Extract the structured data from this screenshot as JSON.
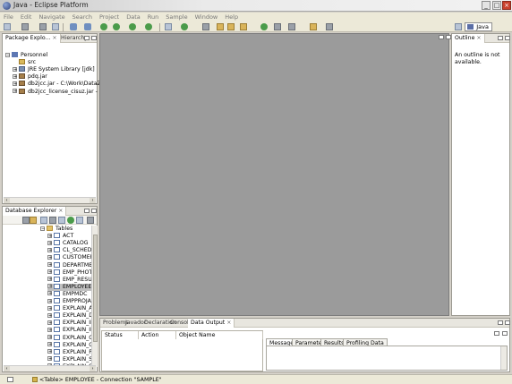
{
  "window": {
    "title": "Java - Eclipse Platform",
    "buttons": {
      "minimize": "_",
      "maximize": "□",
      "close": "×"
    }
  },
  "menu": [
    "File",
    "Edit",
    "Navigate",
    "Search",
    "Project",
    "Data",
    "Run",
    "Sample",
    "Window",
    "Help"
  ],
  "perspective": {
    "label": "Java"
  },
  "package_explorer": {
    "tabs": [
      {
        "label": "Package Explo...",
        "close": "×"
      },
      {
        "label": "Hierarchy"
      }
    ],
    "tree": [
      {
        "label": "Personnel",
        "expander": "−",
        "icon": "project-icon",
        "depth": 0
      },
      {
        "label": "src",
        "expander": "",
        "icon": "source-folder-icon",
        "depth": 1
      },
      {
        "label": "JRE System Library [jdk]",
        "expander": "+",
        "icon": "library-icon",
        "depth": 1
      },
      {
        "label": "pdq.jar",
        "expander": "+",
        "icon": "jar-icon",
        "depth": 1
      },
      {
        "label": "db2jcc.jar - C:\\Work\\DataZero\\",
        "expander": "+",
        "icon": "jar-icon",
        "depth": 1
      },
      {
        "label": "db2jcc_license_cisuz.jar - C:\\W",
        "expander": "+",
        "icon": "jar-icon",
        "depth": 1
      }
    ],
    "scroll": {
      "left": "‹",
      "right": "›"
    }
  },
  "database_explorer": {
    "tab": {
      "label": "Database Explorer",
      "close": "×"
    },
    "tree": [
      {
        "label": "Tables",
        "expander": "−",
        "icon": "folder-icon",
        "depth": 0
      },
      {
        "label": "ACT",
        "expander": "+",
        "icon": "table-icon",
        "depth": 1
      },
      {
        "label": "CATALOG",
        "expander": "+",
        "icon": "table-icon",
        "depth": 1
      },
      {
        "label": "CL_SCHED",
        "expander": "+",
        "icon": "table-icon",
        "depth": 1
      },
      {
        "label": "CUSTOMER",
        "expander": "+",
        "icon": "table-icon",
        "depth": 1
      },
      {
        "label": "DEPARTMEN",
        "expander": "+",
        "icon": "table-icon",
        "depth": 1
      },
      {
        "label": "EMP_PHOTO",
        "expander": "+",
        "icon": "table-icon",
        "depth": 1
      },
      {
        "label": "EMP_RESUM",
        "expander": "+",
        "icon": "table-icon",
        "depth": 1
      },
      {
        "label": "EMPLOYEE",
        "expander": "+",
        "icon": "table-icon",
        "depth": 1,
        "selected": true
      },
      {
        "label": "EMPMDC",
        "expander": "+",
        "icon": "table-icon",
        "depth": 1
      },
      {
        "label": "EMPPROJAC",
        "expander": "+",
        "icon": "table-icon",
        "depth": 1
      },
      {
        "label": "EXPLAIN_AR",
        "expander": "+",
        "icon": "table-icon",
        "depth": 1
      },
      {
        "label": "EXPLAIN_DI",
        "expander": "+",
        "icon": "table-icon",
        "depth": 1
      },
      {
        "label": "EXPLAIN_IN",
        "expander": "+",
        "icon": "table-icon",
        "depth": 1
      },
      {
        "label": "EXPLAIN_IN",
        "expander": "+",
        "icon": "table-icon",
        "depth": 1
      },
      {
        "label": "EXPLAIN_OB",
        "expander": "+",
        "icon": "table-icon",
        "depth": 1
      },
      {
        "label": "EXPLAIN_OP",
        "expander": "+",
        "icon": "table-icon",
        "depth": 1
      },
      {
        "label": "EXPLAIN_PR",
        "expander": "+",
        "icon": "table-icon",
        "depth": 1
      },
      {
        "label": "EXPLAIN_ST",
        "expander": "+",
        "icon": "table-icon",
        "depth": 1
      },
      {
        "label": "EXPLAIN_ST",
        "expander": "+",
        "icon": "table-icon",
        "depth": 1
      }
    ],
    "scroll": {
      "left": "‹",
      "right": "›"
    }
  },
  "outline": {
    "tab": {
      "label": "Outline",
      "close": "×"
    },
    "message": "An outline is not available."
  },
  "bottom_panel": {
    "tabs": [
      {
        "label": "Problems"
      },
      {
        "label": "Javadoc"
      },
      {
        "label": "Declaration"
      },
      {
        "label": "Console"
      },
      {
        "label": "Data Output",
        "active": true,
        "close": "×"
      }
    ],
    "columns": [
      "Status",
      "Action",
      "Object Name"
    ],
    "result_tabs": [
      "Messages",
      "Parameters",
      "Results",
      "Profiling Data"
    ]
  },
  "status_bar": {
    "message": "<Table> EMPLOYEE - Connection \"SAMPLE\""
  },
  "colors": {
    "selection": "#c0c0c0",
    "tab_bg": "#e8e6df",
    "window_bg": "#d4d0c8"
  }
}
